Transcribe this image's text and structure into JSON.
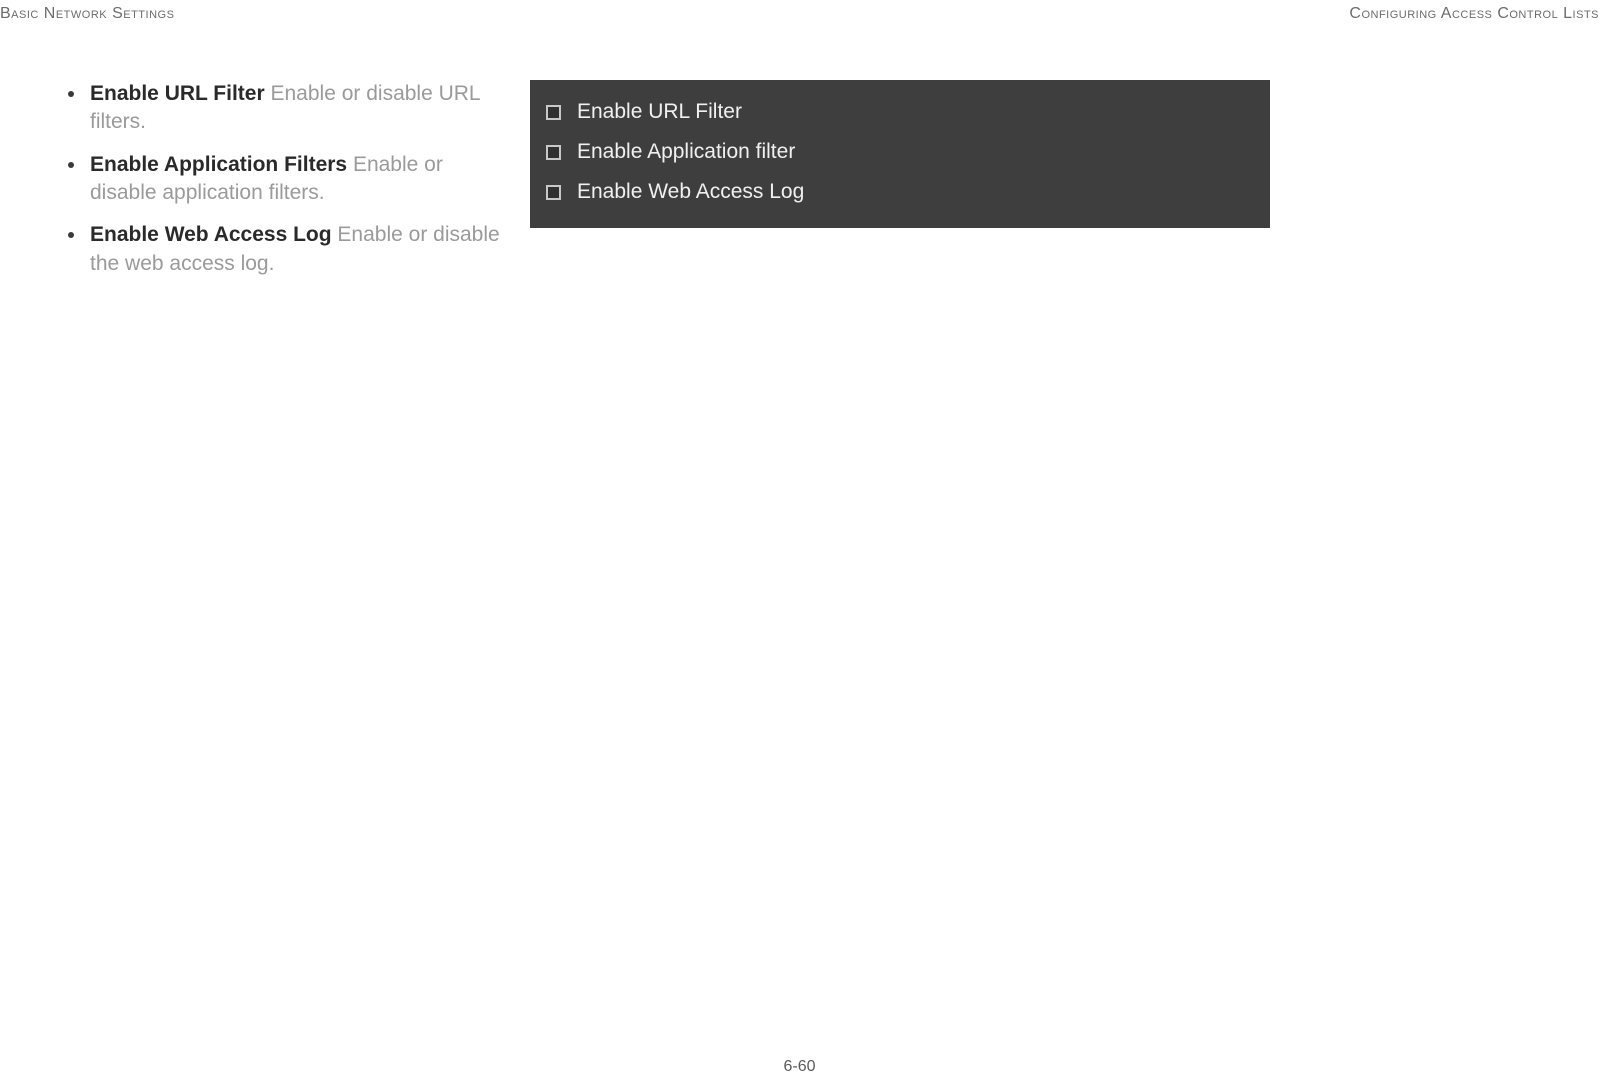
{
  "header": {
    "left": "Basic Network Settings",
    "right": "Configuring Access Control Lists"
  },
  "bullets": [
    {
      "term": "Enable URL Filter",
      "desc": "  Enable or disable URL filters."
    },
    {
      "term": "Enable Application Filters",
      "desc": "  Enable or disable application filters."
    },
    {
      "term": "Enable Web Access Log",
      "desc": "  Enable or disable the web access log."
    }
  ],
  "panel": {
    "items": [
      {
        "label": "Enable URL Filter"
      },
      {
        "label": "Enable Application filter"
      },
      {
        "label": "Enable Web Access Log"
      }
    ]
  },
  "page_number": "6-60"
}
